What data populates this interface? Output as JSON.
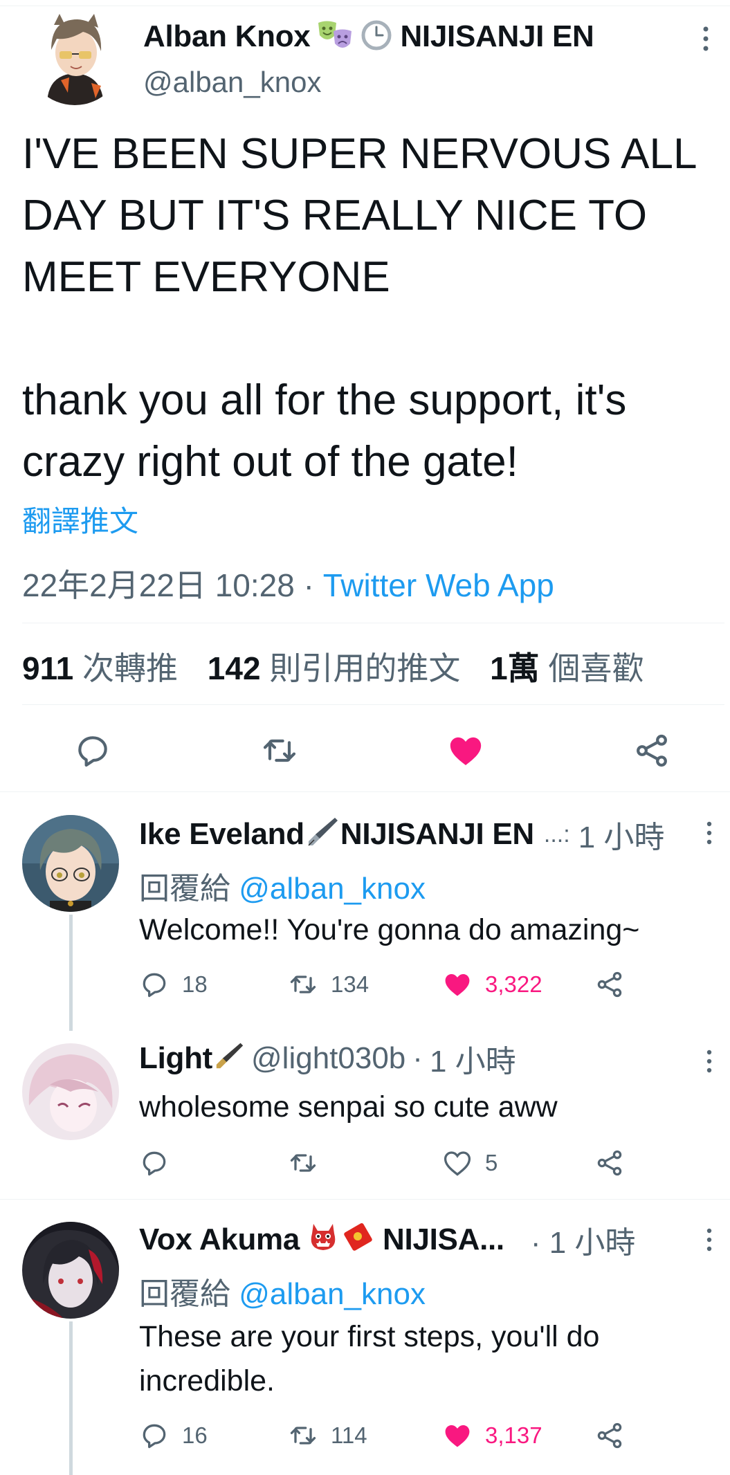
{
  "main_tweet": {
    "author_name": "Alban Knox",
    "author_emojis": [
      "performing-arts-emoji",
      "clock-emoji"
    ],
    "org_name": "NIJISANJI EN",
    "handle": "@alban_knox",
    "text_para1": "I'VE BEEN SUPER NERVOUS ALL DAY BUT IT'S REALLY NICE TO MEET EVERYONE",
    "text_para2": "thank you all for the support, it's crazy right out of the gate!",
    "translate_label": "翻譯推文",
    "timestamp": "22年2月22日 10:28",
    "separator": "·",
    "source": "Twitter Web App",
    "stats": {
      "retweets_count": "911",
      "retweets_label": "次轉推",
      "quotes_count": "142",
      "quotes_label": "則引用的推文",
      "likes_count": "1萬",
      "likes_label": "個喜歡"
    },
    "liked": true
  },
  "replies": [
    {
      "name": "Ike Eveland",
      "name_emoji": "fountain-pen-emoji",
      "org": "NIJISANJI EN",
      "ellipsis": "...:",
      "time": "1 小時",
      "reply_to_label": "回覆給",
      "reply_to_handle": "@alban_knox",
      "text": "Welcome!! You're gonna do amazing~",
      "reply_count": "18",
      "retweet_count": "134",
      "like_count": "3,322",
      "liked": true
    },
    {
      "name": "Light",
      "name_emoji": "fountain-pen-emoji",
      "handle": "@light030b",
      "separator": "·",
      "time": "1 小時",
      "text": "wholesome senpai so cute aww",
      "like_count": "5",
      "liked": false
    },
    {
      "name": "Vox Akuma",
      "name_emojis": [
        "ogre-emoji",
        "red-envelope-emoji"
      ],
      "org": "NIJISA...",
      "time": "· 1 小時",
      "reply_to_label": "回覆給",
      "reply_to_handle": "@alban_knox",
      "text": "These are your first steps, you'll do incredible.",
      "reply_count": "16",
      "retweet_count": "114",
      "like_count": "3,137",
      "liked": true
    }
  ],
  "colors": {
    "text": "#0f1419",
    "muted": "#536471",
    "link": "#1d9bf0",
    "like": "#f91880",
    "divider": "#eff3f4",
    "thread_line": "#cfd9de"
  }
}
